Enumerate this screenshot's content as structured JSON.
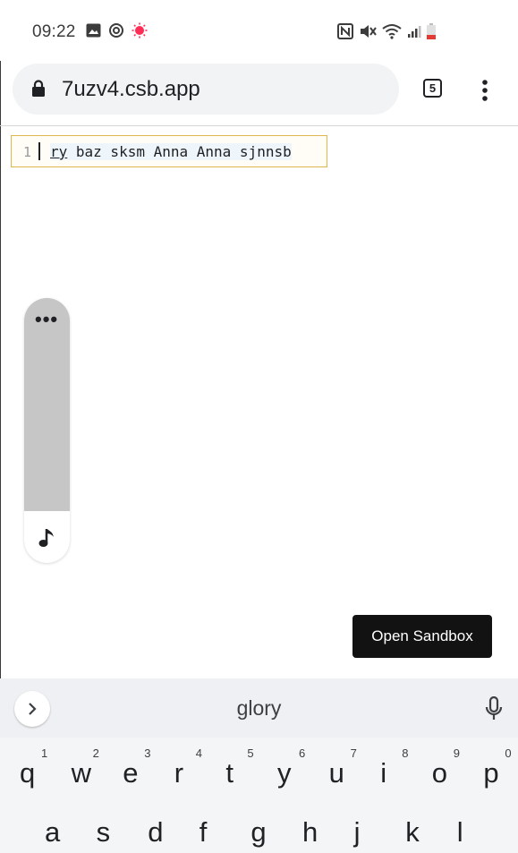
{
  "status_bar": {
    "time": "09:22",
    "left_icons": [
      "image-icon",
      "sync-icon",
      "record-icon"
    ],
    "right_icons": [
      "nfc-icon",
      "mute-icon",
      "wifi-icon",
      "signal-icon",
      "battery-icon"
    ]
  },
  "browser": {
    "url": "7uzv4.csb.app",
    "tab_count": "5"
  },
  "editor": {
    "line_number": "1",
    "underlined_word": "ry",
    "rest_text": " baz sksm Anna Anna sjnnsb"
  },
  "floating_panel": {
    "more_label": "•••"
  },
  "open_sandbox": {
    "label": "Open Sandbox"
  },
  "keyboard": {
    "suggestion": "glory",
    "row1": [
      {
        "letter": "q",
        "hint": "1"
      },
      {
        "letter": "w",
        "hint": "2"
      },
      {
        "letter": "e",
        "hint": "3"
      },
      {
        "letter": "r",
        "hint": "4"
      },
      {
        "letter": "t",
        "hint": "5"
      },
      {
        "letter": "y",
        "hint": "6"
      },
      {
        "letter": "u",
        "hint": "7"
      },
      {
        "letter": "i",
        "hint": "8"
      },
      {
        "letter": "o",
        "hint": "9"
      },
      {
        "letter": "p",
        "hint": "0"
      }
    ],
    "row2": [
      {
        "letter": "a"
      },
      {
        "letter": "s"
      },
      {
        "letter": "d"
      },
      {
        "letter": "f"
      },
      {
        "letter": "g"
      },
      {
        "letter": "h"
      },
      {
        "letter": "j"
      },
      {
        "letter": "k"
      },
      {
        "letter": "l"
      }
    ]
  },
  "colors": {
    "accent_border": "#e0b653",
    "record_red": "#ff2d55",
    "button_dark": "#121212"
  }
}
